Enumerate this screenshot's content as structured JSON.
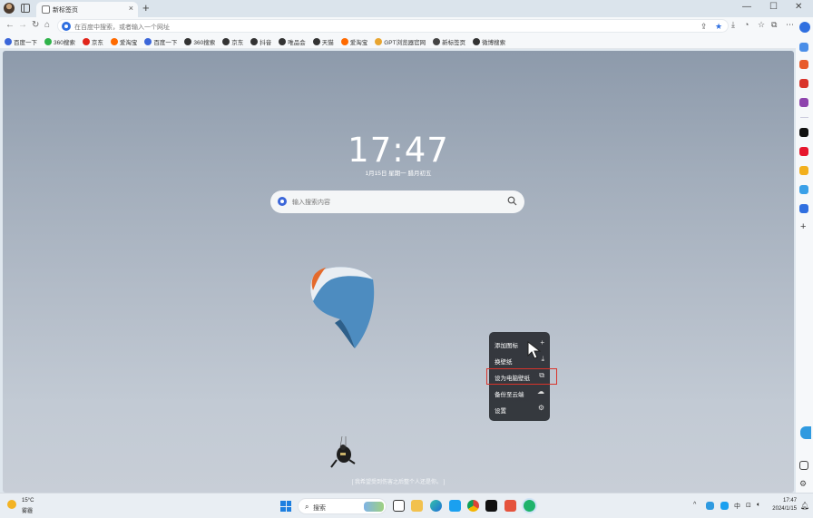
{
  "browser": {
    "tab": {
      "title": "新标签页",
      "close": "×"
    },
    "new_tab": "+",
    "window_controls": [
      "—",
      "☐",
      "✕"
    ],
    "address_bar": {
      "placeholder": "在百度中搜索，或者输入一个网址"
    },
    "bookmarks": [
      {
        "label": "百度一下",
        "icon": "baidu-icon",
        "color": "#3b66d9"
      },
      {
        "label": "360搜索",
        "icon": "360-icon",
        "color": "#2fb34a"
      },
      {
        "label": "京东",
        "icon": "jd-icon",
        "color": "#e1251b"
      },
      {
        "label": "爱淘宝",
        "icon": "aitaobao-icon",
        "color": "#ff6a00"
      },
      {
        "label": "百度一下",
        "icon": "baidu-icon",
        "color": "#3b66d9"
      },
      {
        "label": "360搜索",
        "icon": "globe-icon",
        "color": "#333333"
      },
      {
        "label": "京东",
        "icon": "globe-icon",
        "color": "#333333"
      },
      {
        "label": "抖音",
        "icon": "globe-icon",
        "color": "#333333"
      },
      {
        "label": "唯品会",
        "icon": "globe-icon",
        "color": "#333333"
      },
      {
        "label": "天猫",
        "icon": "globe-icon",
        "color": "#333333"
      },
      {
        "label": "爱淘宝",
        "icon": "aitaobao-icon",
        "color": "#ff6a00"
      },
      {
        "label": "GPT浏览器官网",
        "icon": "gpt-icon",
        "color": "#e8a530"
      },
      {
        "label": "新标签页",
        "icon": "page-icon",
        "color": "#444444"
      },
      {
        "label": "微博搜索",
        "icon": "globe-icon",
        "color": "#333333"
      }
    ]
  },
  "newtab": {
    "time": "17:47",
    "date": "1月15日 星期一 腊月初五",
    "search_placeholder": "输入搜索内容",
    "slogan": "[ 我希望受到伤害之后整个人还是你。 ]"
  },
  "context_menu": {
    "items": [
      {
        "label": "添加图标",
        "icon": "+"
      },
      {
        "label": "换壁纸",
        "icon": "⤓"
      },
      {
        "label": "设为电脑壁纸",
        "icon": "⧉"
      },
      {
        "label": "备份至云端",
        "icon": "☁"
      },
      {
        "label": "设置",
        "icon": "⚙"
      }
    ],
    "highlighted_index": 2,
    "highlight_color": "#d9342b"
  },
  "taskbar": {
    "weather": {
      "temp": "15°C",
      "condition": "雾霾"
    },
    "search_label": "搜索",
    "tray": {
      "ime": "中",
      "time": "17:47",
      "date": "2024/1/15"
    }
  }
}
